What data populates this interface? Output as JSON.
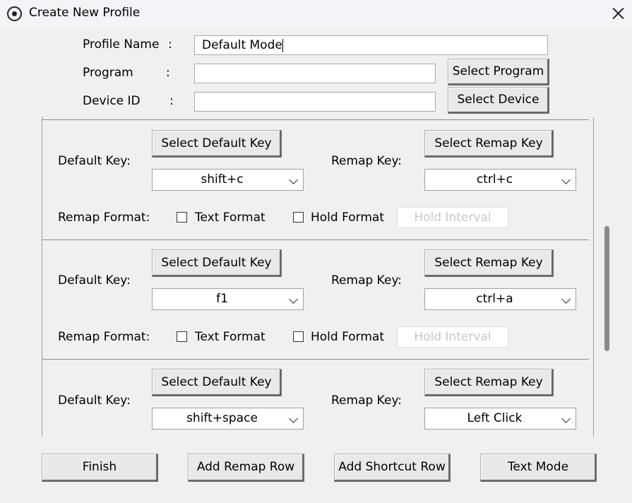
{
  "window": {
    "title": "Create New Profile"
  },
  "form": {
    "colon": ":",
    "profile_name_label": "Profile Name",
    "profile_name_value": "Default Mode",
    "program_label": "Program",
    "program_value": "",
    "device_label": "Device ID",
    "device_value": "",
    "select_program": "Select Program",
    "select_device": "Select Device"
  },
  "rows": [
    {
      "default_key_label": "Default Key:",
      "select_default": "Select Default Key",
      "default_value": "shift+c",
      "remap_key_label": "Remap Key:",
      "select_remap": "Select Remap Key",
      "remap_value": "ctrl+c",
      "format_label": "Remap Format:",
      "text_format": "Text Format",
      "hold_format": "Hold Format",
      "hold_interval": "Hold Interval"
    },
    {
      "default_key_label": "Default Key:",
      "select_default": "Select Default Key",
      "default_value": "f1",
      "remap_key_label": "Remap Key:",
      "select_remap": "Select Remap Key",
      "remap_value": "ctrl+a",
      "format_label": "Remap Format:",
      "text_format": "Text Format",
      "hold_format": "Hold Format",
      "hold_interval": "Hold Interval"
    },
    {
      "default_key_label": "Default Key:",
      "select_default": "Select Default Key",
      "default_value": "shift+space",
      "remap_key_label": "Remap Key:",
      "select_remap": "Select Remap Key",
      "remap_value": "Left Click"
    }
  ],
  "footer": {
    "finish": "Finish",
    "add_remap_row": "Add Remap Row",
    "add_shortcut_row": "Add Shortcut Row",
    "text_mode": "Text Mode"
  }
}
